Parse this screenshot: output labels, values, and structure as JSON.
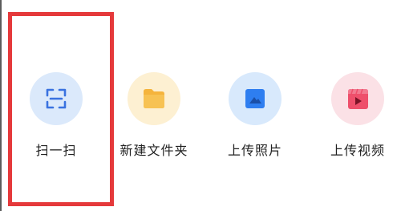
{
  "actions": [
    {
      "label": "扫一扫",
      "icon": "scan-icon",
      "bg_color": "#dbe9fb",
      "icon_color": "#3a72e0"
    },
    {
      "label": "新建文件夹",
      "icon": "folder-icon",
      "bg_color": "#fdf0d2",
      "icon_color": "#f5b43c"
    },
    {
      "label": "上传照片",
      "icon": "photo-icon",
      "bg_color": "#d8e9fc",
      "icon_color": "#2e7ef0"
    },
    {
      "label": "上传视频",
      "icon": "video-icon",
      "bg_color": "#fbe1e6",
      "icon_color": "#ee4f6b"
    }
  ],
  "highlight_color": "#e5393b"
}
